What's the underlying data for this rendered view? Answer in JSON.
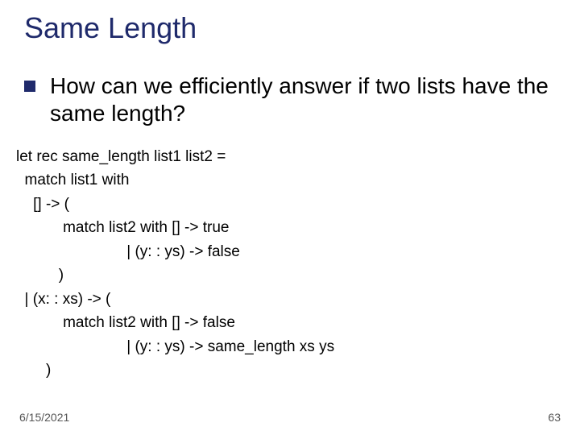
{
  "title": "Same Length",
  "bullet": "How can we efficiently answer if two lists have the same length?",
  "code": "let rec same_length list1 list2 =\n  match list1 with\n    [] -> (\n           match list2 with [] -> true\n                          | (y: : ys) -> false\n          )\n  | (x: : xs) -> (\n           match list2 with [] -> false\n                          | (y: : ys) -> same_length xs ys\n       )",
  "footer": {
    "date": "6/15/2021",
    "page": "63"
  }
}
